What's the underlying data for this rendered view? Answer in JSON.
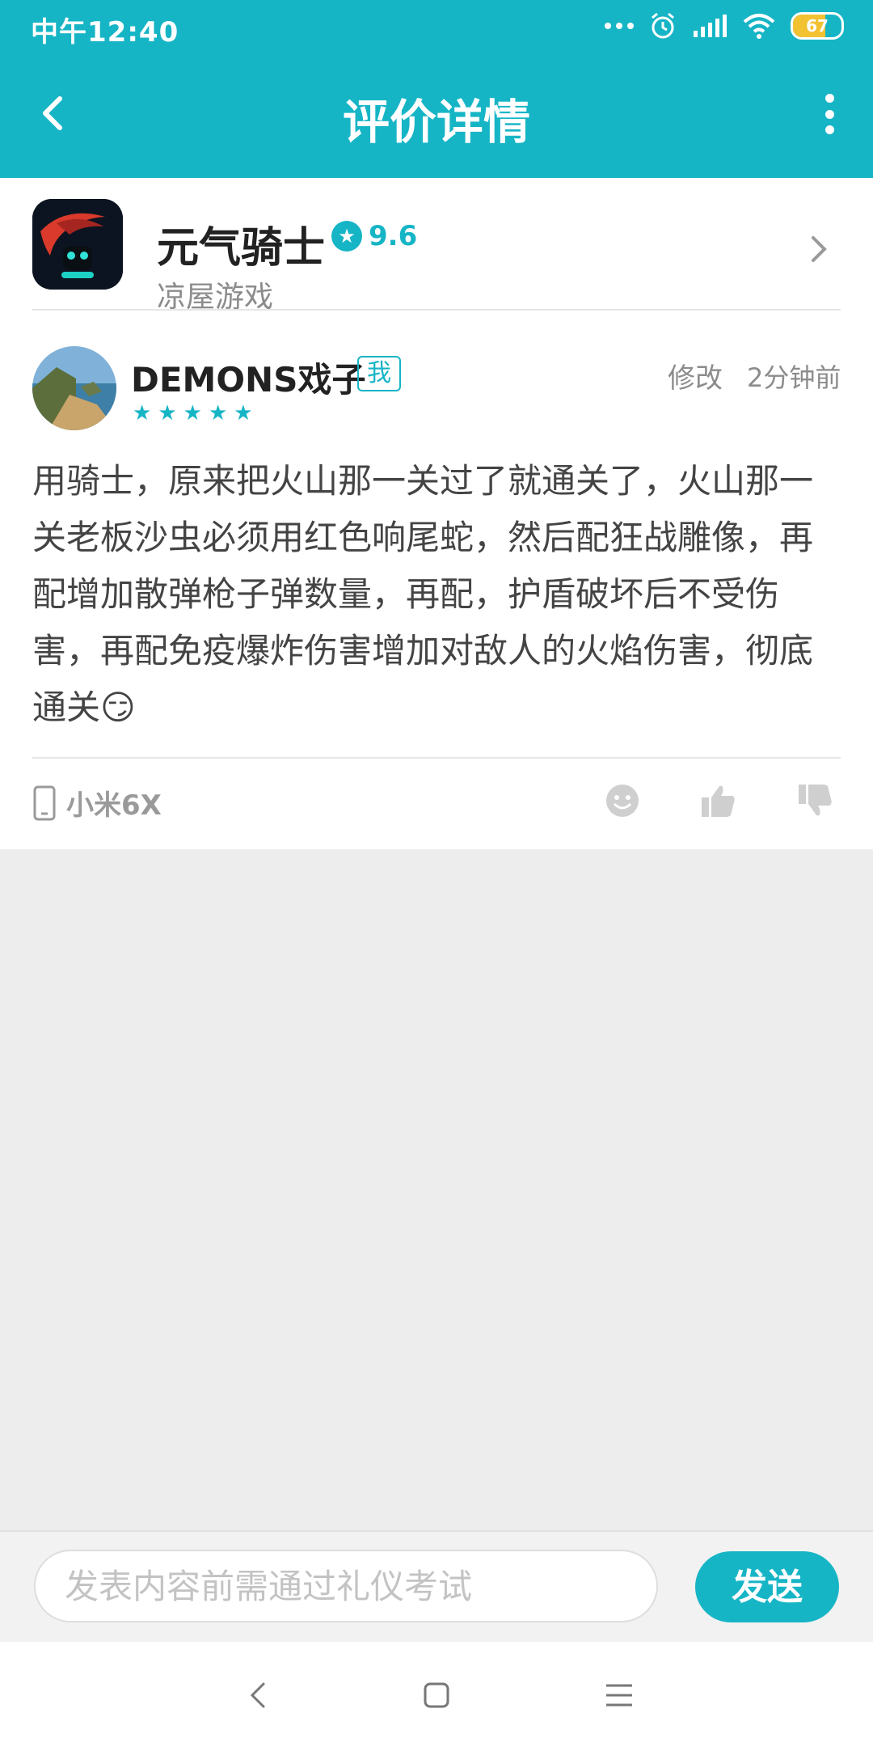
{
  "status_bar": {
    "time": "中午12:40",
    "battery": "67",
    "battery_level": 0.67
  },
  "app_bar": {
    "title": "评价详情"
  },
  "game": {
    "name": "元气骑士",
    "score": "9.6",
    "developer": "凉屋游戏"
  },
  "review": {
    "user": "DEMONS戏子",
    "badge": "我",
    "rating": 5,
    "edit_label": "修改",
    "time": "2分钟前",
    "text": "用骑士，原来把火山那一关过了就通关了，火山那一关老板沙虫必须用红色响尾蛇，然后配狂战雕像，再配增加散弹枪子弹数量，再配，护盾破坏后不受伤害，再配免疫爆炸伤害增加对敌人的火焰伤害，彻底通关😏",
    "device": "小米6X"
  },
  "input_bar": {
    "placeholder": "发表内容前需通过礼仪考试",
    "send_label": "发送"
  },
  "colors": {
    "accent": "#16b5c6",
    "background": "#ededed"
  }
}
